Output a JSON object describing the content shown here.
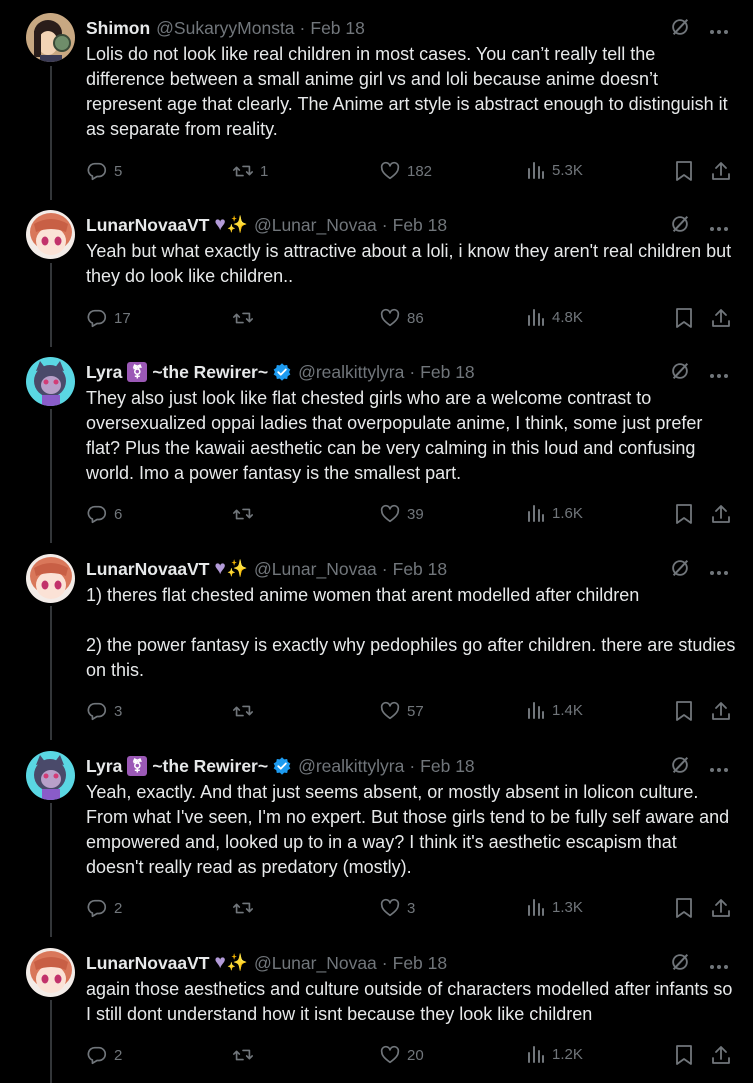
{
  "colors": {
    "background": "#000000",
    "text": "#e7e9ea",
    "muted": "#71767b",
    "verified": "#1d9bf0"
  },
  "tweets": [
    {
      "name": "Shimon",
      "handle": "@SukaryyMonsta",
      "date": "Feb 18",
      "paragraphs": [
        "Lolis do not look like real children in most cases. You can’t really tell the difference between a small anime girl vs and loli because anime doesn’t represent age that clearly. The Anime art style is abstract enough to distinguish it as separate from reality."
      ],
      "replies": "5",
      "retweets": "1",
      "likes": "182",
      "views": "5.3K"
    },
    {
      "name": "LunarNovaaVT",
      "handle": "@Lunar_Novaa",
      "date": "Feb 18",
      "paragraphs": [
        "Yeah but what exactly is attractive about a loli, i know they aren't real children but they do look like children.."
      ],
      "replies": "17",
      "retweets": "",
      "likes": "86",
      "views": "4.8K"
    },
    {
      "name": "Lyra",
      "name_suffix": "~the Rewirer~",
      "handle": "@realkittylyra",
      "date": "Feb 18",
      "paragraphs": [
        "They also just look like flat chested girls who are a welcome contrast to oversexualized oppai ladies that overpopulate anime, I think, some just prefer flat? Plus the kawaii aesthetic can be very calming in this loud and confusing world. Imo a power fantasy is the smallest part."
      ],
      "replies": "6",
      "retweets": "",
      "likes": "39",
      "views": "1.6K"
    },
    {
      "name": "LunarNovaaVT",
      "handle": "@Lunar_Novaa",
      "date": "Feb 18",
      "paragraphs": [
        "1) theres flat chested anime women that arent modelled after children",
        "2) the power fantasy is exactly why pedophiles go after children. there are studies on this."
      ],
      "replies": "3",
      "retweets": "",
      "likes": "57",
      "views": "1.4K"
    },
    {
      "name": "Lyra",
      "name_suffix": "~the Rewirer~",
      "handle": "@realkittylyra",
      "date": "Feb 18",
      "paragraphs": [
        "Yeah, exactly. And that just seems absent, or mostly absent in lolicon culture. From what I've seen, I'm no expert. But those girls tend to be fully self aware and empowered and, looked up to in a way? I think it's aesthetic escapism that doesn't really read as predatory (mostly)."
      ],
      "replies": "2",
      "retweets": "",
      "likes": "3",
      "views": "1.3K"
    },
    {
      "name": "LunarNovaaVT",
      "handle": "@Lunar_Novaa",
      "date": "Feb 18",
      "paragraphs": [
        "again those aesthetics and culture outside of characters modelled after infants so I still dont understand how it isnt because they look like children"
      ],
      "replies": "2",
      "retweets": "",
      "likes": "20",
      "views": "1.2K"
    }
  ]
}
